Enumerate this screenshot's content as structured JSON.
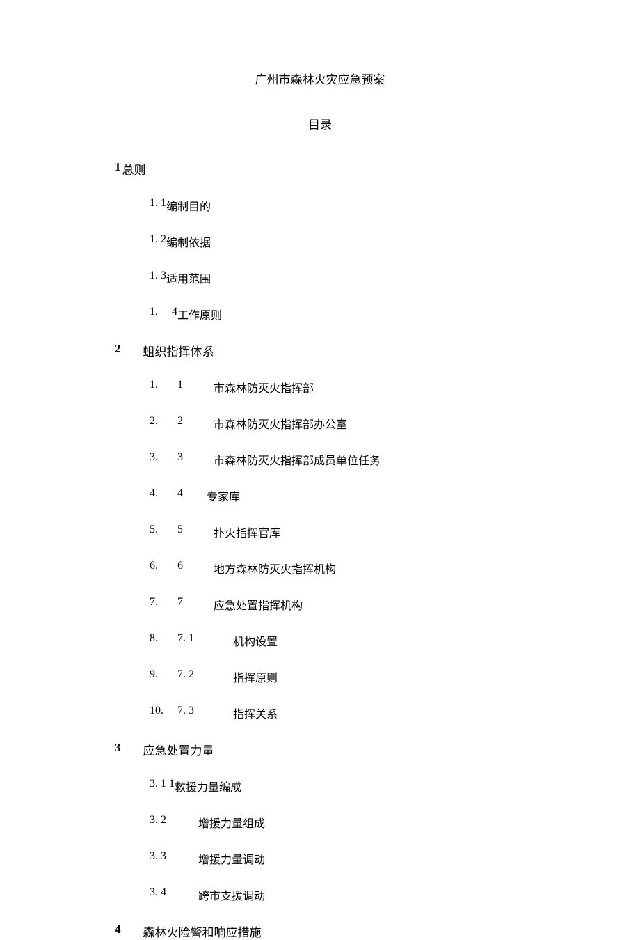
{
  "title": "广州市森林火灾应急预案",
  "toc_label": "目录",
  "sections": {
    "s1": {
      "num": "1",
      "title": "总则"
    },
    "s2": {
      "num": "2",
      "title": "蛆织指挥体系"
    },
    "s3": {
      "num": "3",
      "title": "应急处置力量"
    },
    "s4": {
      "num": "4",
      "title": "森林火险警和响应措施"
    }
  },
  "s1_items": {
    "i1": {
      "idx": "1. 1",
      "txt": "编制目的"
    },
    "i2": {
      "idx": "1. 2",
      "txt": "编制依据"
    },
    "i3": {
      "idx": "1. 3",
      "txt": "适用范围"
    },
    "i4": {
      "idx": "1.",
      "sub": "4",
      "txt": "工作原则"
    }
  },
  "s2_items": {
    "i1": {
      "idx": "1.",
      "sub": "1",
      "txt": "市森林防灭火指挥部"
    },
    "i2": {
      "idx": "2.",
      "sub": "2",
      "txt": "市森林防灭火指挥部办公室"
    },
    "i3": {
      "idx": "3.",
      "sub": "3",
      "txt": "市森林防灭火指挥部成员单位任务"
    },
    "i4": {
      "idx": "4.",
      "sub": "4",
      "txt": "专家库"
    },
    "i5": {
      "idx": "5.",
      "sub": "5",
      "txt": "扑火指挥官库"
    },
    "i6": {
      "idx": "6.",
      "sub": "6",
      "txt": "地方森林防灭火指挥机构"
    },
    "i7": {
      "idx": "7.",
      "sub": "7",
      "txt": "应急处置指挥机构"
    },
    "i8": {
      "idx": "8.",
      "sub": "7. 1",
      "txt": "机构设置"
    },
    "i9": {
      "idx": "9.",
      "sub": "7. 2",
      "txt": "指挥原则"
    },
    "i10": {
      "idx": "10.",
      "sub": "7. 3",
      "txt": "指挥关系"
    }
  },
  "s3_items": {
    "i1": {
      "idx": "3. 1 1",
      "txt": "救援力量编成"
    },
    "i2": {
      "idx": "3. 2",
      "txt": "增援力量组成"
    },
    "i3": {
      "idx": "3. 3",
      "txt": "增援力量调动"
    },
    "i4": {
      "idx": "3. 4",
      "txt": "跨市支援调动"
    }
  }
}
